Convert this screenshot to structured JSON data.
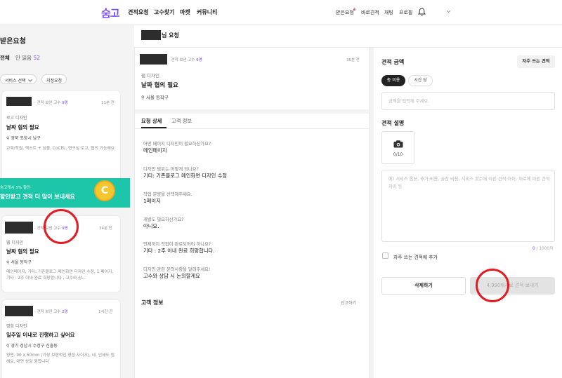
{
  "header": {
    "logo": "숨고",
    "nav": [
      "견적요청",
      "고수찾기",
      "마켓",
      "커뮤니티"
    ],
    "right_nav": [
      "받은요청",
      "바로견적",
      "채팅",
      "프로필"
    ],
    "bell_icon": "bell-icon",
    "chevron_icon": "chevron-down-icon",
    "accent": "#7b4ff7",
    "notice_dot": "#f5415c"
  },
  "sidebar": {
    "title": "받은요청",
    "tab_all": "전체",
    "tab_unread": "안 읽음",
    "unread_count": "52",
    "filter_service": "서비스 선택",
    "filter_designated": "지정요청",
    "cards": [
      {
        "sent_prefix": "· 견적 보낸 고수",
        "sent_count": "9명",
        "time": "11분 전",
        "category": "로고 디자인",
        "title": "날짜 협의 필요",
        "location": "경북 포항시 남구",
        "snippet": "교육/학원, 텍스트 + 심볼, CoCEL, 연구실 로고, 협의 가능해요"
      },
      {
        "sent_prefix": "· 견적 보낸 고수",
        "sent_count": "9명",
        "time": "34분 전",
        "category": "웹 디자인",
        "title": "날짜 협의 필요",
        "location": "서울 동작구",
        "snippet": "메인페이지, 기타: 기존블로그 메인화면 디자인 수정, 1 페이지, 기타 : 2주 이내 완료 희망합니다 , 고수와 상..."
      },
      {
        "sent_prefix": "· 견적 보낸 고수",
        "sent_count": "2명",
        "time": "1시간 전",
        "category": "명함 디자인",
        "title": "일주일 이내로 진행하고 싶어요",
        "location": "경기 성남시 수정구 신흥동",
        "snippet": "양면, 90 x 50mm (가장 보편적인 명함 사이즈), 네, 인쇄도 원해요, 대면 상담 원합니다"
      }
    ],
    "banner": {
      "line1": "숨고캐시 5% 할인",
      "line2": "할인받고 견적 더 많이 보내세요",
      "coin": "C"
    }
  },
  "page_title": "님 요청",
  "request": {
    "sent_prefix": "· 견적 보낸 고수",
    "sent_count": "9명",
    "time": "35분 전",
    "category": "웹 디자인",
    "title": "날짜 협의 필요",
    "location": "서울 동작구",
    "tab_detail": "요청 상세",
    "tab_customer": "고객 정보",
    "qa": [
      {
        "q": "어떤 페이지 디자인이 필요하신가요?",
        "a": "메인페이지"
      },
      {
        "q": "디자인 범위는 어떻게 되나요?",
        "a": "기타: 기존블로그 메인화면 디자인 수정"
      },
      {
        "q": "작업 분량을 선택해주세요.",
        "a": "1페이지"
      },
      {
        "q": "개발도 필요하신가요?",
        "a": "아니요."
      },
      {
        "q": "언제까지 작업이 완료되어야 하나요?",
        "a": "기타 : 2주 이내 완료 희망합니다."
      },
      {
        "q": "디자인 관련 문의사항을 알려주세요!",
        "a": "고수와 상담 시 논의할게요"
      }
    ],
    "customer_section": "고객 정보",
    "report": "신고하기"
  },
  "quote": {
    "amount_title": "견적 금액",
    "frequent_btn": "자주 쓰는 견적",
    "total_cost": "총 비용",
    "per_hour": "시간 당",
    "amount_placeholder": "금액을 입력해 주세요.",
    "desc_title": "견적 설명",
    "photo_count": "0/10",
    "camera_icon": "camera-icon",
    "desc_placeholder": "예) 서비스 옵션, 추가 비용, 출장 비용, 서비스 횟수에 따른 견적 차이, 재료에 따른 견적 차이 등",
    "char_used": "0",
    "char_max": "/ 1000자",
    "checkbox_label": "자주 쓰는 견적에 추가",
    "delete_btn": "삭제하기",
    "send_btn": "4,990캐시로 견적 보내기"
  }
}
